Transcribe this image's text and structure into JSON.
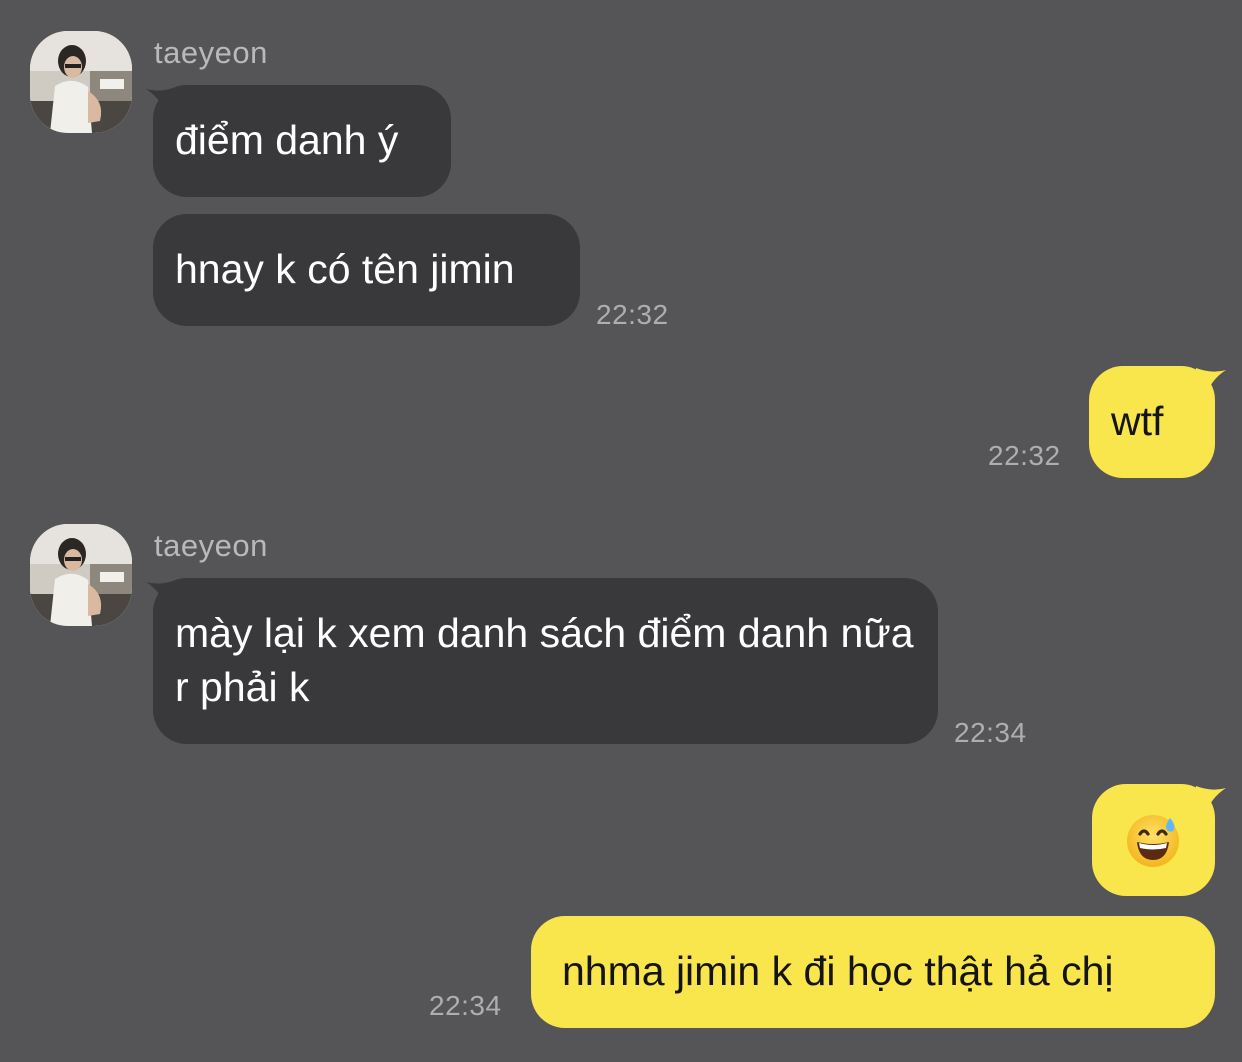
{
  "chat": {
    "messages": [
      {
        "direction": "incoming",
        "sender": "taeyeon",
        "bubbles": [
          "điểm danh ý",
          "hnay k có tên jimin"
        ],
        "time": "22:32"
      },
      {
        "direction": "outgoing",
        "bubbles": [
          "wtf"
        ],
        "time": "22:32"
      },
      {
        "direction": "incoming",
        "sender": "taeyeon",
        "bubbles": [
          "mày lại k xem danh sách điểm danh nữa r phải k"
        ],
        "time": "22:34"
      },
      {
        "direction": "outgoing",
        "bubbles": [
          "grinning-face-with-sweat-emoji",
          "nhma jimin k đi học thật hả chị"
        ],
        "time": "22:34"
      }
    ]
  },
  "colors": {
    "background": "#555456",
    "incoming_bubble": "#39383b",
    "outgoing_bubble": "#f9e54c",
    "timestamp": "#aeadb0",
    "sender_name": "#b9b8ba"
  }
}
